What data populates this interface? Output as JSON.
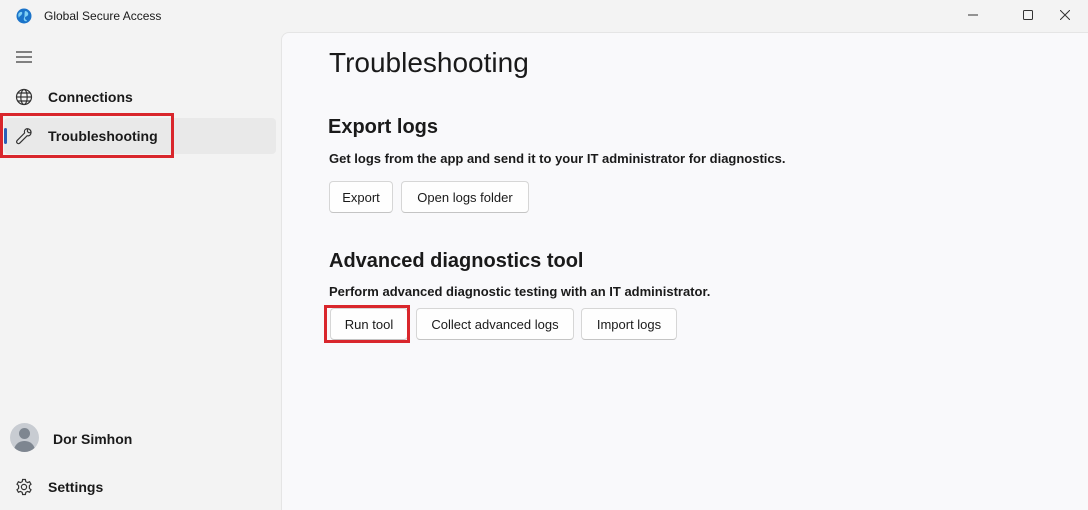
{
  "window": {
    "title": "Global Secure Access",
    "controls": {
      "minimize": "minimize-icon",
      "maximize": "maximize-icon",
      "close": "close-icon"
    }
  },
  "sidebar": {
    "menu_icon": "hamburger-icon",
    "items": [
      {
        "label": "Connections",
        "icon": "globe-icon",
        "selected": false
      },
      {
        "label": "Troubleshooting",
        "icon": "wrench-icon",
        "selected": true
      }
    ],
    "user": {
      "name": "Dor Simhon",
      "avatar": "person-avatar"
    },
    "settings": {
      "label": "Settings",
      "icon": "gear-icon"
    }
  },
  "main": {
    "title": "Troubleshooting",
    "sections": [
      {
        "title": "Export logs",
        "description": "Get logs from the app and send it to your IT administrator for diagnostics.",
        "buttons": [
          "Export",
          "Open logs folder"
        ]
      },
      {
        "title": "Advanced diagnostics tool",
        "description": "Perform advanced diagnostic testing with an IT administrator.",
        "buttons": [
          "Run tool",
          "Collect advanced logs",
          "Import logs"
        ]
      }
    ]
  },
  "colors": {
    "accent": "#2b5fb8",
    "highlight": "#d9262c",
    "sidebar_bg": "#f3f3f3",
    "content_bg": "#f9f9fb"
  }
}
